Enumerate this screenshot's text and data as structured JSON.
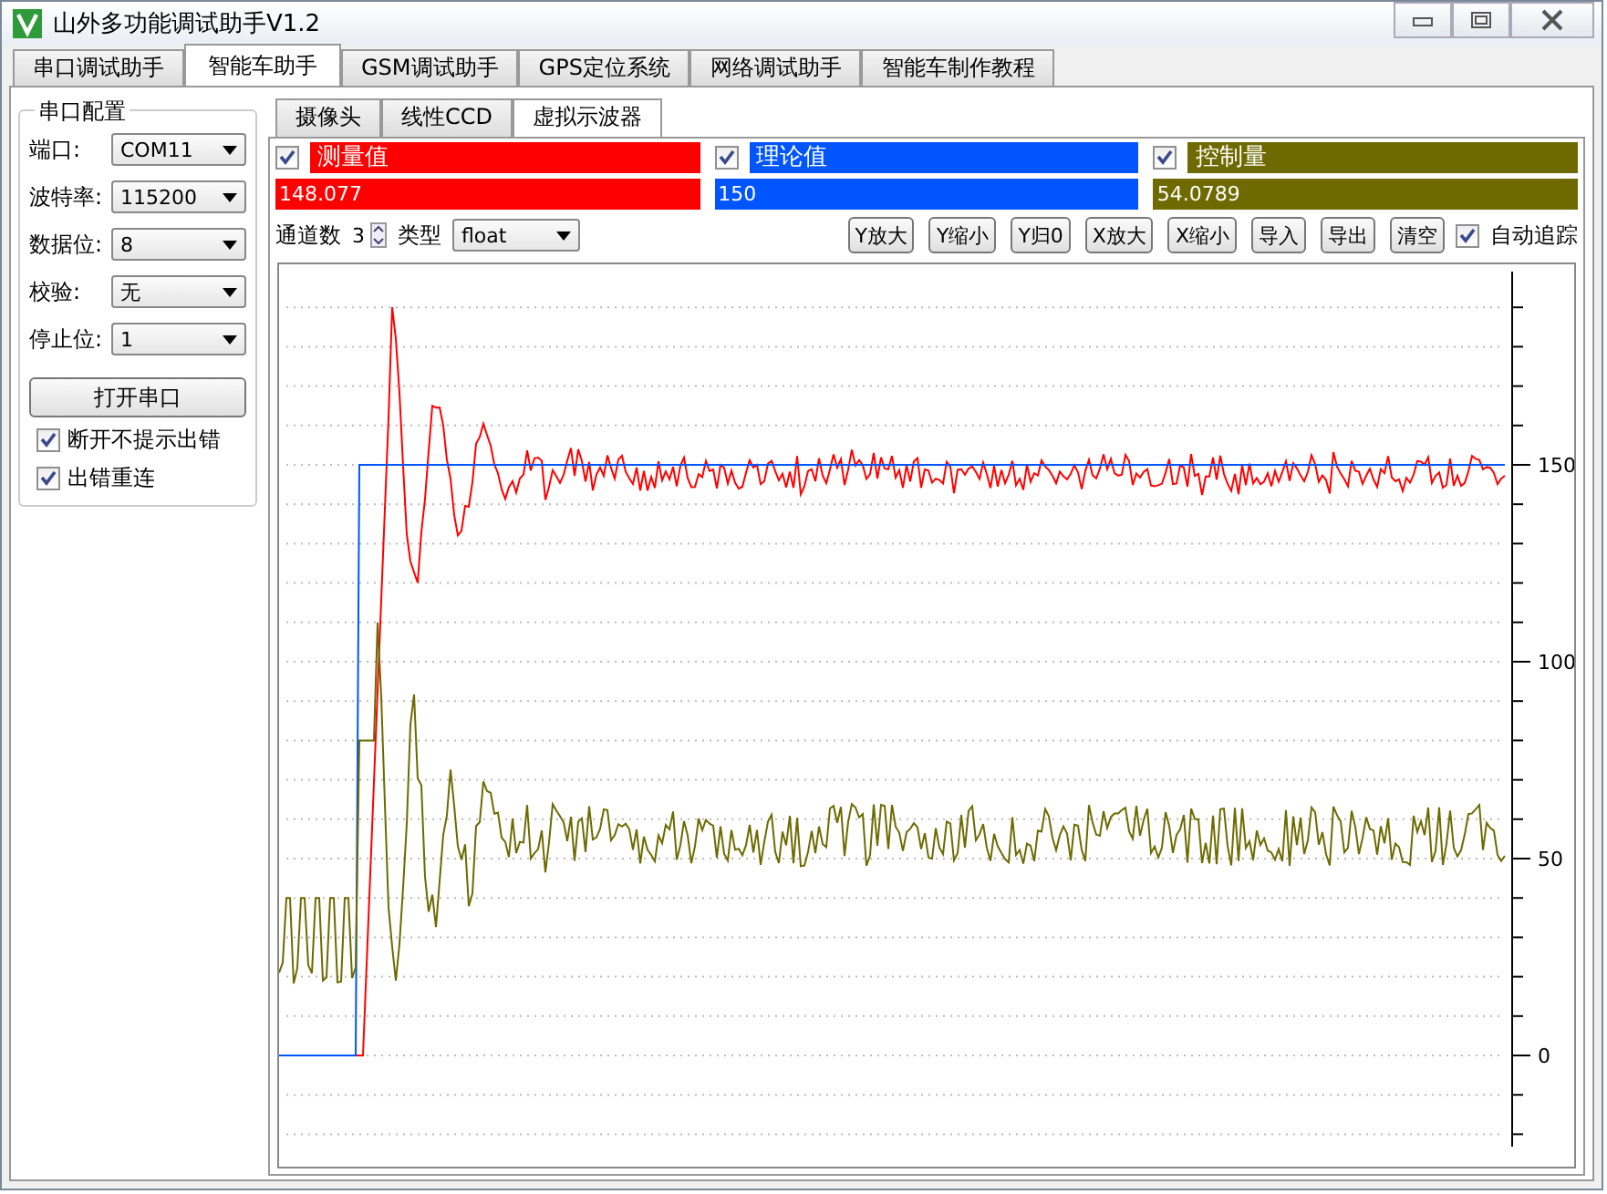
{
  "window": {
    "title": "山外多功能调试助手V1.2"
  },
  "tabs": [
    {
      "label": "串口调试助手",
      "selected": false
    },
    {
      "label": "智能车助手",
      "selected": true
    },
    {
      "label": "GSM调试助手",
      "selected": false
    },
    {
      "label": "GPS定位系统",
      "selected": false
    },
    {
      "label": "网络调试助手",
      "selected": false
    },
    {
      "label": "智能车制作教程",
      "selected": false
    }
  ],
  "serial_config": {
    "title": "串口配置",
    "fields": [
      {
        "label": "端口:",
        "value": "COM11"
      },
      {
        "label": "波特率:",
        "value": "115200"
      },
      {
        "label": "数据位:",
        "value": "8"
      },
      {
        "label": "校验:",
        "value": "无"
      },
      {
        "label": "停止位:",
        "value": "1"
      }
    ],
    "open_button": "打开串口",
    "options": [
      {
        "label": "断开不提示出错",
        "checked": true
      },
      {
        "label": "出错重连",
        "checked": true
      }
    ]
  },
  "sub_tabs": [
    {
      "label": "摄像头",
      "selected": false
    },
    {
      "label": "线性CCD",
      "selected": false
    },
    {
      "label": "虚拟示波器",
      "selected": true
    }
  ],
  "channels": [
    {
      "name": "测量值",
      "checked": true,
      "color": "#ff0000",
      "reading": "148.077"
    },
    {
      "name": "理论值",
      "checked": true,
      "color": "#0055ff",
      "reading": "150"
    },
    {
      "name": "控制量",
      "checked": true,
      "color": "#6e6a00",
      "reading": "54.0789"
    }
  ],
  "channel_count": {
    "label": "通道数",
    "value": "3"
  },
  "type": {
    "label": "类型",
    "value": "float"
  },
  "buttons": [
    "Y放大",
    "Y缩小",
    "Y归0",
    "X放大",
    "X缩小",
    "导入",
    "导出",
    "清空"
  ],
  "auto_track": {
    "label": "自动追踪",
    "checked": true
  },
  "scope": {
    "y_labels": [
      "150",
      "100",
      "50",
      "0"
    ]
  }
}
